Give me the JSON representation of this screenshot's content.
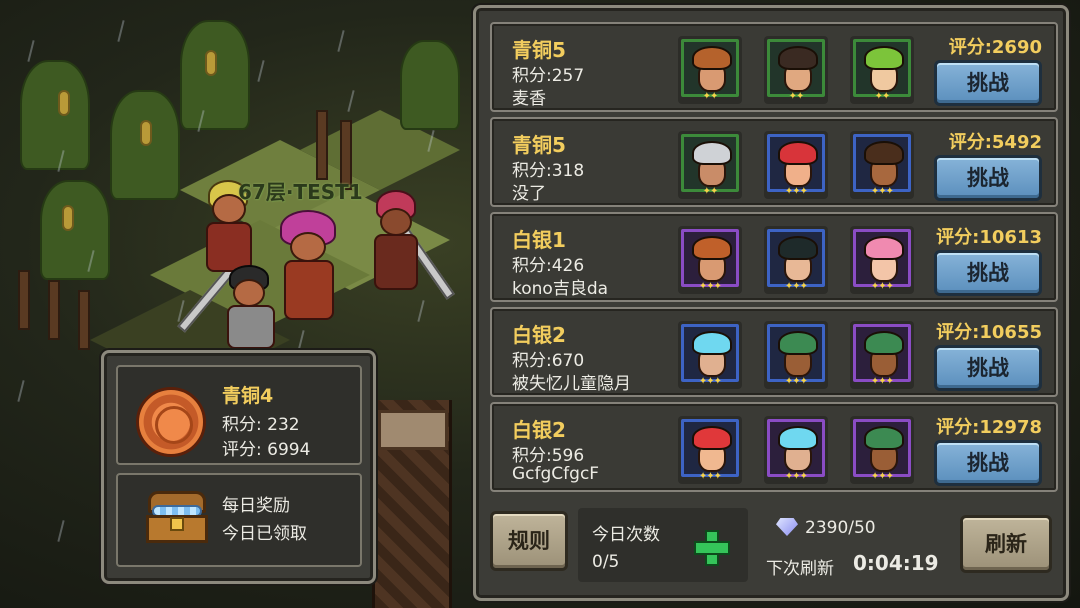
{
  "scene": {
    "floor_label": "67层·TEST1"
  },
  "player_info": {
    "rank": "青铜4",
    "points": "积分: 232",
    "score": "评分: 6994",
    "medal_icon": "bronze-medal-icon",
    "reward_title": "每日奖励",
    "reward_status": "今日已领取",
    "reward_icon": "treasure-chest-icon"
  },
  "opponents": [
    {
      "tier": "青铜5",
      "points": "积分:257",
      "name": "麦香",
      "score": "评分:2690",
      "button": "挑战",
      "heroes": [
        {
          "frame": "green",
          "hair": "#b5622c",
          "skin": "#d99a72",
          "stars": "✦✦"
        },
        {
          "frame": "green",
          "hair": "#3a2a22",
          "skin": "#e0a880",
          "stars": "✦✦"
        },
        {
          "frame": "green",
          "hair": "#7cc43a",
          "skin": "#f0c9a0",
          "stars": "✦✦"
        }
      ]
    },
    {
      "tier": "青铜5",
      "points": "积分:318",
      "name": "没了",
      "score": "评分:5492",
      "button": "挑战",
      "heroes": [
        {
          "frame": "green",
          "hair": "#cfd2d6",
          "skin": "#c98c68",
          "stars": "✦✦"
        },
        {
          "frame": "blue",
          "hair": "#d8343a",
          "skin": "#f0b08a",
          "stars": "✦✦✦"
        },
        {
          "frame": "blue",
          "hair": "#4a2e1c",
          "skin": "#a8683e",
          "stars": "✦✦✦"
        }
      ]
    },
    {
      "tier": "白银1",
      "points": "积分:426",
      "name": "kono吉良da",
      "score": "评分:10613",
      "button": "挑战",
      "heroes": [
        {
          "frame": "purple",
          "hair": "#c0602a",
          "skin": "#d99a72",
          "stars": "✦✦✦"
        },
        {
          "frame": "blue",
          "hair": "#1e2a2a",
          "skin": "#e8b896",
          "stars": "✦✦✦"
        },
        {
          "frame": "purple",
          "hair": "#f08ab0",
          "skin": "#f3c5a8",
          "stars": "✦✦✦"
        }
      ]
    },
    {
      "tier": "白银2",
      "points": "积分:670",
      "name": "被失忆儿童隐月",
      "score": "评分:10655",
      "button": "挑战",
      "heroes": [
        {
          "frame": "blue",
          "hair": "#6fd8f0",
          "skin": "#e0b090",
          "stars": "✦✦✦"
        },
        {
          "frame": "blue",
          "hair": "#3c8a52",
          "skin": "#9a5e36",
          "stars": "✦✦✦"
        },
        {
          "frame": "purple",
          "hair": "#3c8a52",
          "skin": "#9a5e36",
          "stars": "✦✦✦"
        }
      ]
    },
    {
      "tier": "白银2",
      "points": "积分:596",
      "name": "GcfgCfgcF",
      "score": "评分:12978",
      "button": "挑战",
      "heroes": [
        {
          "frame": "blue",
          "hair": "#e0383a",
          "skin": "#f0b890",
          "stars": "✦✦✦"
        },
        {
          "frame": "purple",
          "hair": "#6fd8f0",
          "skin": "#e0b090",
          "stars": "✦✦✦"
        },
        {
          "frame": "purple",
          "hair": "#3c8a52",
          "skin": "#9a5e36",
          "stars": "✦✦✦"
        }
      ]
    }
  ],
  "footer": {
    "rules_button": "规则",
    "attempts_label": "今日次数",
    "attempts_value": "0/5",
    "add_icon": "plus-icon",
    "gem_icon": "diamond-icon",
    "gems": "2390/50",
    "next_refresh_label": "下次刷新",
    "next_refresh_time": "0:04:19",
    "refresh_button": "刷新"
  }
}
